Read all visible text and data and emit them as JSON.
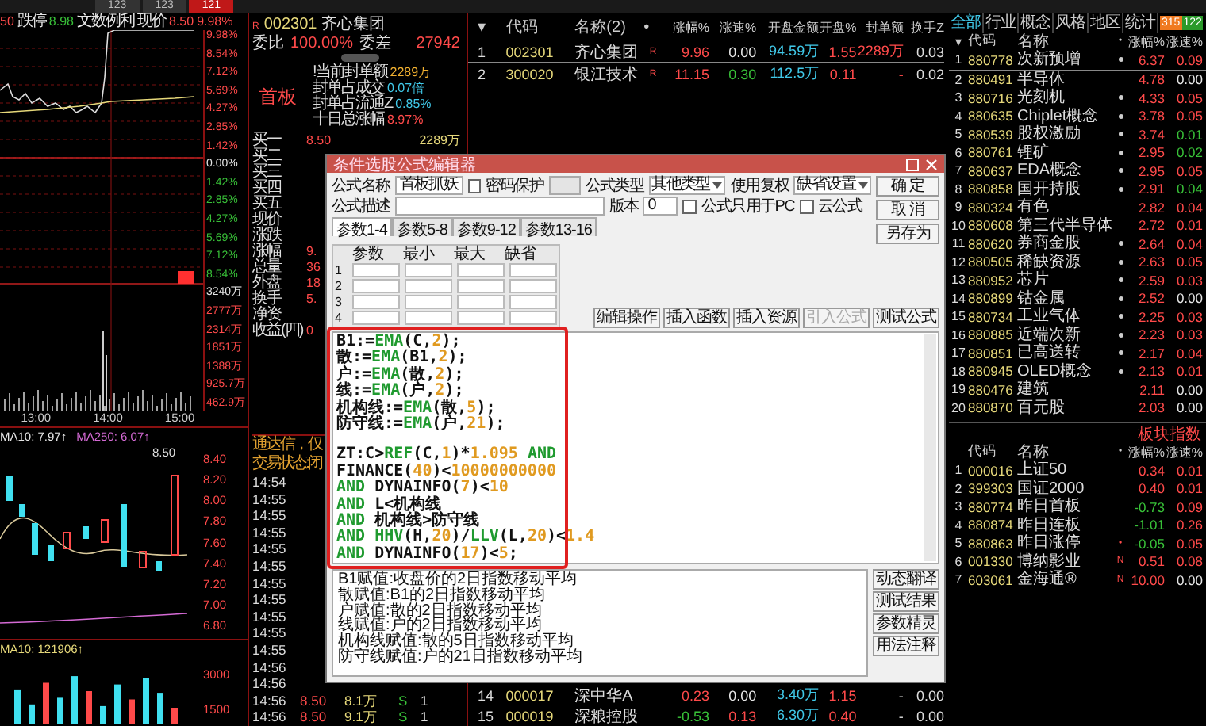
{
  "top_tabs": [
    {
      "label": "123",
      "selected": false
    },
    {
      "label": "123",
      "selected": false
    },
    {
      "label": "121",
      "selected": true
    }
  ],
  "intraday": {
    "header": [
      {
        "text": "50",
        "color": "#ff4a4a"
      },
      {
        "text": "跌停",
        "color": "#e6e6e6"
      },
      {
        "text": "8.98",
        "color": "#38c038"
      },
      {
        "text": "文数例利",
        "color": "#e6e6e6"
      },
      {
        "text": "现价",
        "color": "#e6e6e6"
      },
      {
        "text": "8.50",
        "color": "#ff4a4a"
      },
      {
        "text": "9.98%",
        "color": "#ff4a4a"
      }
    ],
    "axis": [
      {
        "text": "9.98%",
        "color": "#ff4a4a"
      },
      {
        "text": "8.54%",
        "color": "#ff4a4a"
      },
      {
        "text": "7.12%",
        "color": "#ff4a4a"
      },
      {
        "text": "5.69%",
        "color": "#ff4a4a"
      },
      {
        "text": "4.27%",
        "color": "#ff4a4a"
      },
      {
        "text": "2.85%",
        "color": "#ff4a4a"
      },
      {
        "text": "1.42%",
        "color": "#ff4a4a"
      },
      {
        "text": "0.00%",
        "color": "#e6e6e6"
      },
      {
        "text": "1.42%",
        "color": "#38c038"
      },
      {
        "text": "2.85%",
        "color": "#38c038"
      },
      {
        "text": "4.27%",
        "color": "#38c038"
      },
      {
        "text": "5.69%",
        "color": "#38c038"
      },
      {
        "text": "7.12%",
        "color": "#38c038"
      },
      {
        "text": "8.54%",
        "color": "#38c038"
      },
      {
        "text": "3240万",
        "color": "#e6e6e6"
      },
      {
        "text": "2777万",
        "color": "#ff4a4a"
      },
      {
        "text": "2314万",
        "color": "#ff4a4a"
      },
      {
        "text": "1851万",
        "color": "#ff4a4a"
      },
      {
        "text": "1388万",
        "color": "#ff4a4a"
      },
      {
        "text": "925.7万",
        "color": "#ff4a4a"
      },
      {
        "text": "462.9万",
        "color": "#ff4a4a"
      }
    ],
    "times": [
      "13:00",
      "14:00",
      "15:00"
    ]
  },
  "kline": {
    "ma": [
      {
        "text": "MA10: 7.97↑",
        "color": "#e6e6e6"
      },
      {
        "text": "MA250: 6.07↑",
        "color": "#d46ad4"
      }
    ],
    "high_label": "8.50",
    "axis": [
      "8.40",
      "8.20",
      "8.00",
      "7.80",
      "7.60",
      "7.40",
      "7.20",
      "7.00",
      "6.80"
    ],
    "volume_ma": "MA10: 121906↑",
    "volume_axis": [
      "3000",
      "1500"
    ]
  },
  "quote": {
    "market_mark": "R",
    "code": "002301",
    "name": "齐心集团",
    "ratio_label": "委比",
    "ratio": "100.00%",
    "diff_label": "委差",
    "diff": "27942",
    "board": "首板",
    "stats": [
      {
        "label": "!当前封单额",
        "value": "2289万",
        "color": "#f0b030"
      },
      {
        "label": "封单占成交",
        "value": "0.07倍",
        "color": "#40c8e8"
      },
      {
        "label": "封单占流通Z",
        "value": "0.85%",
        "color": "#40c8e8"
      },
      {
        "label": "十日总涨幅",
        "value": "8.97%",
        "color": "#ff4a4a"
      }
    ],
    "rows": [
      {
        "label": "买一",
        "value": "8.50",
        "amount": "2289万"
      },
      {
        "label": "买二"
      },
      {
        "label": "买三"
      },
      {
        "label": "买四"
      },
      {
        "label": "买五"
      },
      {
        "label": "现价"
      },
      {
        "label": "涨跌"
      },
      {
        "label": "涨幅",
        "value": "9."
      },
      {
        "label": "总量",
        "value": "36"
      },
      {
        "label": "外盘",
        "value": "18"
      },
      {
        "label": "换手",
        "value": "5."
      },
      {
        "label": "净资"
      },
      {
        "label": "收益(四)",
        "value": "0"
      }
    ]
  },
  "ticker": {
    "notice": "通达信，仅",
    "status": "交易状态:闭",
    "ticks": [
      {
        "time": "14:54"
      },
      {
        "time": "14:55"
      },
      {
        "time": "14:55"
      },
      {
        "time": "14:55"
      },
      {
        "time": "14:55"
      },
      {
        "time": "14:55"
      },
      {
        "time": "14:55"
      },
      {
        "time": "14:55"
      },
      {
        "time": "14:55"
      },
      {
        "time": "14:55"
      },
      {
        "time": "14:55"
      },
      {
        "time": "14:56"
      },
      {
        "time": "14:56"
      },
      {
        "time": "14:56",
        "price": "8.50",
        "volume": "8.1万",
        "side": "S",
        "count": "1"
      },
      {
        "time": "14:56",
        "price": "8.50",
        "volume": "9.1万",
        "side": "S",
        "count": "1"
      }
    ]
  },
  "watchlist": {
    "columns": [
      "▾",
      "代码",
      "名称(2)",
      "•",
      "涨幅%",
      "涨速%",
      "开盘金额",
      "开盘%",
      "封单额",
      "换手Z"
    ],
    "rows": [
      {
        "index": "1",
        "code": "002301",
        "name": "齐心集团",
        "mark": "R",
        "change": {
          "text": "9.96",
          "color": "#ff4a4a"
        },
        "speed": {
          "text": "0.00",
          "color": "#e6e6e6"
        },
        "open_amount": "94.59万",
        "open_pct": "1.55",
        "seal": "2289万",
        "turnover": "0.03",
        "selected": true
      },
      {
        "index": "2",
        "code": "300020",
        "name": "银江技术",
        "mark": "R",
        "change": {
          "text": "11.15",
          "color": "#ff4a4a"
        },
        "speed": {
          "text": "0.30",
          "color": "#38c038"
        },
        "open_amount": "112.5万",
        "open_pct": "0.11",
        "seal": "-",
        "turnover": "0.02",
        "selected": false
      }
    ],
    "bottom_rows": [
      {
        "index": "14",
        "code": "000017",
        "name": "深中华A",
        "change": {
          "text": "0.23",
          "color": "#ff4a4a"
        },
        "speed": {
          "text": "0.00",
          "color": "#e6e6e6"
        },
        "open_amount": "3.40万",
        "open_pct": "1.15",
        "seal": "-",
        "turnover": "0.00",
        "selected": false
      },
      {
        "index": "15",
        "code": "000019",
        "name": "深粮控股",
        "change": {
          "text": "-0.53",
          "color": "#38c038"
        },
        "speed": {
          "text": "0.13",
          "color": "#ff4a4a"
        },
        "open_amount": "6.30万",
        "open_pct": "0.40",
        "seal": "-",
        "turnover": "0.00",
        "selected": false
      }
    ]
  },
  "sector_tabs": [
    {
      "label": "全部",
      "selected": true
    },
    {
      "label": "行业",
      "selected": false
    },
    {
      "label": "概念",
      "selected": false
    },
    {
      "label": "风格",
      "selected": false
    },
    {
      "label": "地区",
      "selected": false
    },
    {
      "label": "统计",
      "selected": false
    }
  ],
  "sector_counts": {
    "up": "315",
    "down": "122"
  },
  "sector_table": {
    "columns": [
      "▾",
      "代码",
      "名称",
      "•",
      "涨幅%",
      "涨速%"
    ],
    "rows": [
      {
        "index": "1",
        "code": "880778",
        "name": "次新预增",
        "dot": true,
        "change": "6.37",
        "speed": {
          "text": "0.09",
          "color": "#ff4a4a"
        },
        "selected": true
      },
      {
        "index": "2",
        "code": "880491",
        "name": "半导体",
        "dot": false,
        "change": "4.78",
        "speed": {
          "text": "0.00",
          "color": "#e6e6e6"
        },
        "selected": false
      },
      {
        "index": "3",
        "code": "880716",
        "name": "光刻机",
        "dot": true,
        "change": "4.33",
        "speed": {
          "text": "0.05",
          "color": "#ff4a4a"
        },
        "selected": false
      },
      {
        "index": "4",
        "code": "880635",
        "name": "Chiplet概念",
        "dot": true,
        "change": "3.78",
        "speed": {
          "text": "0.05",
          "color": "#ff4a4a"
        },
        "selected": false
      },
      {
        "index": "5",
        "code": "880539",
        "name": "股权激励",
        "dot": true,
        "change": "3.74",
        "speed": {
          "text": "0.01",
          "color": "#38c038"
        },
        "selected": false
      },
      {
        "index": "6",
        "code": "880761",
        "name": "锂矿",
        "dot": true,
        "change": "2.95",
        "speed": {
          "text": "0.02",
          "color": "#38c038"
        },
        "selected": false
      },
      {
        "index": "7",
        "code": "880637",
        "name": "EDA概念",
        "dot": true,
        "change": "2.95",
        "speed": {
          "text": "0.05",
          "color": "#ff4a4a"
        },
        "selected": false
      },
      {
        "index": "8",
        "code": "880858",
        "name": "国开持股",
        "dot": true,
        "change": "2.91",
        "speed": {
          "text": "0.04",
          "color": "#38c038"
        },
        "selected": false
      },
      {
        "index": "9",
        "code": "880324",
        "name": "有色",
        "dot": false,
        "change": "2.82",
        "speed": {
          "text": "0.04",
          "color": "#ff4a4a"
        },
        "selected": false
      },
      {
        "index": "10",
        "code": "880608",
        "name": "第三代半导体",
        "dot": false,
        "change": "2.72",
        "speed": {
          "text": "0.01",
          "color": "#ff4a4a"
        },
        "selected": false
      },
      {
        "index": "11",
        "code": "880620",
        "name": "券商金股",
        "dot": true,
        "change": "2.64",
        "speed": {
          "text": "0.04",
          "color": "#ff4a4a"
        },
        "selected": false
      },
      {
        "index": "12",
        "code": "880505",
        "name": "稀缺资源",
        "dot": true,
        "change": "2.63",
        "speed": {
          "text": "0.05",
          "color": "#ff4a4a"
        },
        "selected": false
      },
      {
        "index": "13",
        "code": "880952",
        "name": "芯片",
        "dot": true,
        "change": "2.59",
        "speed": {
          "text": "0.03",
          "color": "#ff4a4a"
        },
        "selected": false
      },
      {
        "index": "14",
        "code": "880899",
        "name": "钴金属",
        "dot": true,
        "change": "2.52",
        "speed": {
          "text": "0.00",
          "color": "#e6e6e6"
        },
        "selected": false
      },
      {
        "index": "15",
        "code": "880734",
        "name": "工业气体",
        "dot": true,
        "change": "2.25",
        "speed": {
          "text": "0.03",
          "color": "#ff4a4a"
        },
        "selected": false
      },
      {
        "index": "16",
        "code": "880885",
        "name": "近端次新",
        "dot": true,
        "change": "2.23",
        "speed": {
          "text": "0.03",
          "color": "#ff4a4a"
        },
        "selected": false
      },
      {
        "index": "17",
        "code": "880851",
        "name": "已高送转",
        "dot": true,
        "change": "2.17",
        "speed": {
          "text": "0.04",
          "color": "#ff4a4a"
        },
        "selected": false
      },
      {
        "index": "18",
        "code": "880945",
        "name": "OLED概念",
        "dot": true,
        "change": "2.13",
        "speed": {
          "text": "0.01",
          "color": "#ff4a4a"
        },
        "selected": false
      },
      {
        "index": "19",
        "code": "880476",
        "name": "建筑",
        "dot": false,
        "change": "2.11",
        "speed": {
          "text": "0.00",
          "color": "#e6e6e6"
        },
        "selected": false
      },
      {
        "index": "20",
        "code": "880870",
        "name": "百元股",
        "dot": false,
        "change": "2.03",
        "speed": {
          "text": "0.00",
          "color": "#e6e6e6"
        },
        "selected": false
      }
    ]
  },
  "index_tabs": [
    {
      "label": "板块指数",
      "selected": true
    }
  ],
  "index_table": {
    "columns": [
      "代码",
      "名称",
      "•",
      "涨幅%",
      "涨速%"
    ],
    "rows": [
      {
        "index": "1",
        "code": "000016",
        "name": "上证50",
        "change": {
          "text": "0.34",
          "color": "#ff4a4a"
        },
        "speed": {
          "text": "0.01",
          "color": "#ff4a4a"
        }
      },
      {
        "index": "2",
        "code": "399303",
        "name": "国证2000",
        "change": {
          "text": "0.40",
          "color": "#ff4a4a"
        },
        "speed": {
          "text": "0.01",
          "color": "#ff4a4a"
        }
      },
      {
        "index": "3",
        "code": "880774",
        "name": "昨日首板",
        "change": {
          "text": "-0.73",
          "color": "#38c038"
        },
        "speed": {
          "text": "0.09",
          "color": "#ff4a4a"
        }
      },
      {
        "index": "4",
        "code": "880874",
        "name": "昨日连板",
        "change": {
          "text": "-1.01",
          "color": "#38c038"
        },
        "speed": {
          "text": "0.26",
          "color": "#ff4a4a"
        }
      },
      {
        "index": "5",
        "code": "880863",
        "name": "昨日涨停",
        "mark": "•",
        "change": {
          "text": "-0.05",
          "color": "#38c038"
        },
        "speed": {
          "text": "0.05",
          "color": "#ff4a4a"
        }
      },
      {
        "index": "6",
        "code": "001330",
        "name": "博纳影业",
        "mark": "N",
        "change": {
          "text": "0.51",
          "color": "#ff4a4a"
        },
        "speed": {
          "text": "0.08",
          "color": "#ff4a4a"
        }
      },
      {
        "index": "7",
        "code": "603061",
        "name": "金海通®",
        "mark": "N",
        "change": {
          "text": "10.00",
          "color": "#ff4a4a"
        },
        "speed": {
          "text": "0.00",
          "color": "#e6e6e6"
        }
      }
    ]
  },
  "editor": {
    "title": "条件选股公式编辑器",
    "name_label": "公式名称",
    "name": "首板抓妖",
    "password_label": "密码保护",
    "password_protected": false,
    "type_label": "公式类型",
    "type": "其他类型",
    "adjust_label": "使用复权",
    "adjust": "缺省设置",
    "desc_label": "公式描述",
    "version_label": "版本",
    "version": "0",
    "pc_only_label": "公式只用于PC",
    "pc_only": false,
    "cloud_label": "云公式",
    "cloud": false,
    "side_buttons": [
      "确 定",
      "取 消",
      "另存为"
    ],
    "param_tabs": [
      {
        "label": "参数1-4",
        "selected": true
      },
      {
        "label": "参数5-8",
        "selected": false
      },
      {
        "label": "参数9-12",
        "selected": false
      },
      {
        "label": "参数13-16",
        "selected": false
      }
    ],
    "param_columns": [
      "参数",
      "最小",
      "最大",
      "缺省"
    ],
    "param_rows": [
      "1",
      "2",
      "3",
      "4"
    ],
    "tool_buttons": [
      {
        "label": "编辑操作",
        "disabled": false
      },
      {
        "label": "插入函数",
        "disabled": false
      },
      {
        "label": "插入资源",
        "disabled": false
      },
      {
        "label": "引入公式",
        "disabled": true
      },
      {
        "label": "测试公式",
        "disabled": false
      }
    ],
    "code_lines": [
      {
        "gap": false,
        "parts": [
          {
            "text": "B1:=",
            "color": "#111111"
          },
          {
            "text": "EMA",
            "color": "#1f9a2f"
          },
          {
            "text": "(C,",
            "color": "#111111"
          },
          {
            "text": "2",
            "color": "#e09a20"
          },
          {
            "text": ");",
            "color": "#111111"
          }
        ]
      },
      {
        "gap": false,
        "parts": [
          {
            "text": "散:=",
            "color": "#111111"
          },
          {
            "text": "EMA",
            "color": "#1f9a2f"
          },
          {
            "text": "(B1,",
            "color": "#111111"
          },
          {
            "text": "2",
            "color": "#e09a20"
          },
          {
            "text": ");",
            "color": "#111111"
          }
        ]
      },
      {
        "gap": false,
        "parts": [
          {
            "text": "户:=",
            "color": "#111111"
          },
          {
            "text": "EMA",
            "color": "#1f9a2f"
          },
          {
            "text": "(散,",
            "color": "#111111"
          },
          {
            "text": "2",
            "color": "#e09a20"
          },
          {
            "text": ");",
            "color": "#111111"
          }
        ]
      },
      {
        "gap": false,
        "parts": [
          {
            "text": "线:=",
            "color": "#111111"
          },
          {
            "text": "EMA",
            "color": "#1f9a2f"
          },
          {
            "text": "(户,",
            "color": "#111111"
          },
          {
            "text": "2",
            "color": "#e09a20"
          },
          {
            "text": ");",
            "color": "#111111"
          }
        ]
      },
      {
        "gap": false,
        "parts": [
          {
            "text": "机构线:=",
            "color": "#111111"
          },
          {
            "text": "EMA",
            "color": "#1f9a2f"
          },
          {
            "text": "(散,",
            "color": "#111111"
          },
          {
            "text": "5",
            "color": "#e09a20"
          },
          {
            "text": ");",
            "color": "#111111"
          }
        ]
      },
      {
        "gap": false,
        "parts": [
          {
            "text": "防守线:=",
            "color": "#111111"
          },
          {
            "text": "EMA",
            "color": "#1f9a2f"
          },
          {
            "text": "(户,",
            "color": "#111111"
          },
          {
            "text": "21",
            "color": "#e09a20"
          },
          {
            "text": ");",
            "color": "#111111"
          }
        ]
      },
      {
        "gap": true,
        "parts": [
          {
            "text": "ZT:C>",
            "color": "#111111"
          },
          {
            "text": "REF",
            "color": "#1f9a2f"
          },
          {
            "text": "(C,",
            "color": "#111111"
          },
          {
            "text": "1",
            "color": "#e09a20"
          },
          {
            "text": ")*",
            "color": "#111111"
          },
          {
            "text": "1.095",
            "color": "#e09a20"
          },
          {
            "text": " AND",
            "color": "#1f9a2f"
          }
        ]
      },
      {
        "gap": false,
        "parts": [
          {
            "text": "FINANCE(",
            "color": "#111111"
          },
          {
            "text": "40",
            "color": "#e09a20"
          },
          {
            "text": ")<",
            "color": "#111111"
          },
          {
            "text": "10000000000",
            "color": "#e09a20"
          }
        ]
      },
      {
        "gap": false,
        "parts": [
          {
            "text": "AND",
            "color": "#1f9a2f"
          },
          {
            "text": " DYNAINFO(",
            "color": "#111111"
          },
          {
            "text": "7",
            "color": "#e09a20"
          },
          {
            "text": ")<",
            "color": "#111111"
          },
          {
            "text": "10",
            "color": "#e09a20"
          }
        ]
      },
      {
        "gap": false,
        "parts": [
          {
            "text": "AND",
            "color": "#1f9a2f"
          },
          {
            "text": " L<机构线",
            "color": "#111111"
          }
        ]
      },
      {
        "gap": false,
        "parts": [
          {
            "text": "AND",
            "color": "#1f9a2f"
          },
          {
            "text": " 机构线>防守线",
            "color": "#111111"
          }
        ]
      },
      {
        "gap": false,
        "parts": [
          {
            "text": "AND HHV",
            "color": "#1f9a2f"
          },
          {
            "text": "(H,",
            "color": "#111111"
          },
          {
            "text": "20",
            "color": "#e09a20"
          },
          {
            "text": ")/",
            "color": "#111111"
          },
          {
            "text": "LLV",
            "color": "#1f9a2f"
          },
          {
            "text": "(L,",
            "color": "#111111"
          },
          {
            "text": "20",
            "color": "#e09a20"
          },
          {
            "text": ")<",
            "color": "#111111"
          },
          {
            "text": "1.4",
            "color": "#e09a20"
          }
        ]
      },
      {
        "gap": false,
        "parts": [
          {
            "text": "AND",
            "color": "#1f9a2f"
          },
          {
            "text": " DYNAINFO(",
            "color": "#111111"
          },
          {
            "text": "17",
            "color": "#e09a20"
          },
          {
            "text": ")<",
            "color": "#111111"
          },
          {
            "text": "5",
            "color": "#e09a20"
          },
          {
            "text": ";",
            "color": "#111111"
          }
        ]
      }
    ],
    "descriptions": [
      "B1赋值:收盘价的2日指数移动平均",
      "散赋值:B1的2日指数移动平均",
      "户赋值:散的2日指数移动平均",
      "线赋值:户的2日指数移动平均",
      "机构线赋值:散的5日指数移动平均",
      "防守线赋值:户的21日指数移动平均"
    ],
    "help_buttons": [
      "动态翻译",
      "测试结果",
      "参数精灵",
      "用法注释"
    ]
  }
}
